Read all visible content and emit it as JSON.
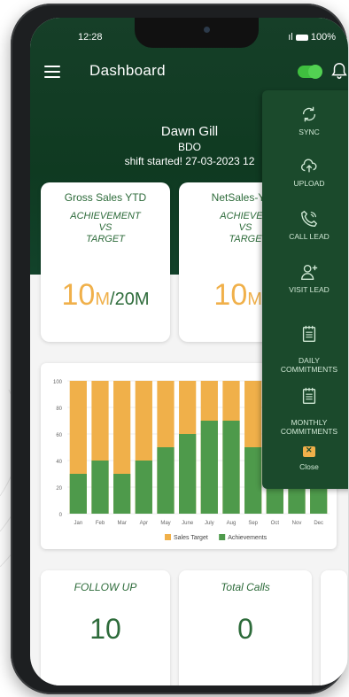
{
  "status_bar": {
    "time": "12:28",
    "battery": "100%"
  },
  "header": {
    "title": "Dashboard"
  },
  "profile": {
    "name": "Dawn Gill",
    "role": "BDO",
    "shift": "shift started!  27-03-2023 12"
  },
  "cards": [
    {
      "title": "Gross Sales YTD",
      "subtitle": "ACHIEVEMENT\nVS\nTARGET",
      "value": "10",
      "unit": "M",
      "target": "/20M"
    },
    {
      "title": "NetSales-YTD",
      "subtitle": "ACHIEVEM\nVS\nTARGE",
      "value": "10",
      "unit": "M",
      "target": "/2"
    }
  ],
  "side_menu": {
    "items": [
      {
        "label": "SYNC",
        "icon": "sync-icon"
      },
      {
        "label": "UPLOAD",
        "icon": "cloud-upload-icon"
      },
      {
        "label": "CALL LEAD",
        "icon": "phone-icon"
      },
      {
        "label": "VISIT LEAD",
        "icon": "add-user-icon"
      },
      {
        "label": "DAILY\nCOMMITMENTS",
        "icon": "calendar-icon"
      },
      {
        "label": "MONTHLY\nCOMMITMENTS",
        "icon": "calendar-icon"
      },
      {
        "label": "Close",
        "icon": "close-icon"
      }
    ]
  },
  "chart_data": {
    "type": "bar",
    "stacked": true,
    "categories": [
      "Jan",
      "Feb",
      "Mar",
      "Apr",
      "May",
      "June",
      "July",
      "Aug",
      "Sep",
      "Oct",
      "Nov",
      "Dec"
    ],
    "series": [
      {
        "name": "Sales Target",
        "values": [
          100,
          100,
          100,
          100,
          100,
          100,
          100,
          100,
          100,
          100,
          100,
          100
        ],
        "color": "#f0b04a"
      },
      {
        "name": "Achievements",
        "values": [
          30,
          40,
          30,
          40,
          50,
          60,
          70,
          70,
          50,
          40,
          40,
          40
        ],
        "color": "#4e9a4b"
      }
    ],
    "ylim": [
      0,
      100
    ],
    "yticks": [
      0,
      20,
      40,
      60,
      80,
      100
    ],
    "legend": "bottom"
  },
  "bottom_cards": [
    {
      "title": "FOLLOW UP",
      "value": "10"
    },
    {
      "title": "Total Calls",
      "value": "0"
    }
  ],
  "colors": {
    "header_green": "#0f3a21",
    "accent_orange": "#f0b04a",
    "bar_green": "#4e9a4b",
    "toggle_green": "#52d152"
  }
}
